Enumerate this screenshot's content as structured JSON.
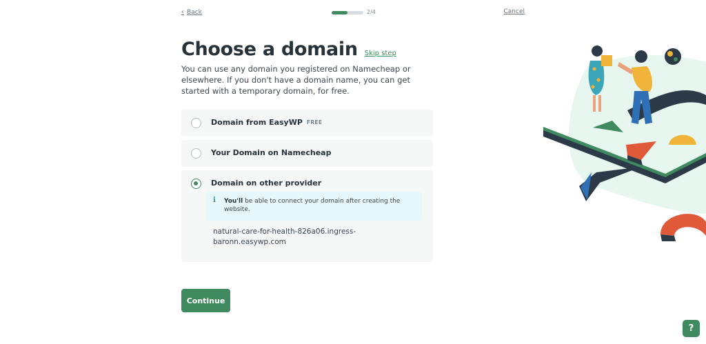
{
  "nav": {
    "back_label": "Back",
    "step_label": "2/4",
    "progress": 0.5,
    "cancel_label": "Cancel"
  },
  "header": {
    "title": "Choose a domain",
    "skip_label": "Skip step",
    "description": "You can use any domain you registered on Namecheap or elsewhere. If you don't have a domain name, you can get started with a temporary domain, for free."
  },
  "options": [
    {
      "label": "Domain from EasyWP",
      "badge": "FREE",
      "selected": false
    },
    {
      "label": "Your Domain on Namecheap",
      "selected": false
    },
    {
      "label": "Domain on other provider",
      "selected": true
    }
  ],
  "info": {
    "bold": "You'll",
    "text": " be able to connect your domain after creating the website."
  },
  "domain_value": "natural-care-for-health-826a06.ingress-baronn.easywp.com",
  "continue_label": "Continue",
  "help_label": "?",
  "colors": {
    "accent": "#3f8a5f",
    "info_bg": "#e7f8fb"
  }
}
